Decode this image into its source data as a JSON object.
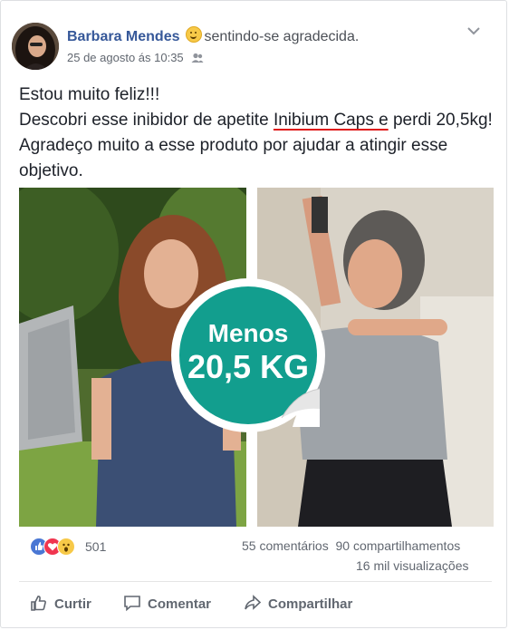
{
  "post": {
    "author": "Barbara Mendes",
    "feeling_icon": "smiling-face-icon",
    "feeling": "sentindo-se agradecida.",
    "timestamp": "25 de agosto ás 10:35",
    "privacy_icon": "friends-icon",
    "text": {
      "line1": "Estou muito feliz!!!",
      "line2_before": "Descobri esse inibidor de apetite ",
      "line2_highlight": "Inibium Caps e",
      "line2_after": " perdi 20,5kg! Agradeço muito a esse produto por ajudar a atingir esse objetivo."
    }
  },
  "badge": {
    "line1": "Menos",
    "line2": "20,5 KG",
    "color": "#129e8e"
  },
  "reactions": {
    "icons": [
      "like-icon",
      "love-icon",
      "wow-icon"
    ],
    "count": "501"
  },
  "stats": {
    "comments": "55 comentários",
    "shares": "90 compartilhamentos",
    "views": "16 mil visualizações"
  },
  "actions": {
    "like": "Curtir",
    "comment": "Comentar",
    "share": "Compartilhar"
  },
  "colors": {
    "author_link": "#365899",
    "highlight_underline": "#e01b1b"
  }
}
